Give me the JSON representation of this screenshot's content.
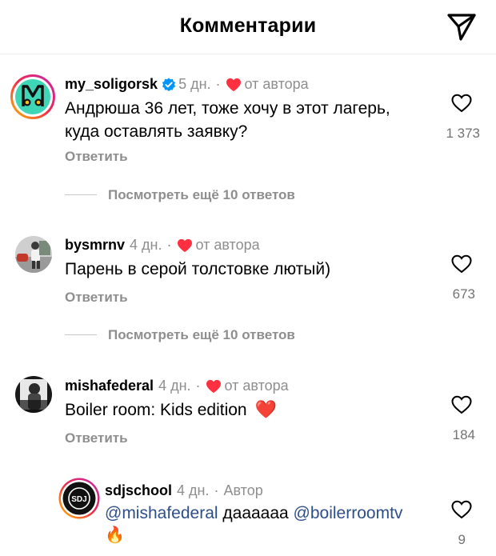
{
  "header": {
    "title": "Комментарии"
  },
  "comments": [
    {
      "username": "my_soligorsk",
      "time": "5 дн.",
      "sep": "·",
      "author_like": "от автора",
      "text_line1": "Андрюша 36 лет, тоже хочу в этот лагерь,",
      "text_line2": "куда оставлять заявку?",
      "reply_label": "Ответить",
      "likes": "1 373",
      "more_replies": "Посмотреть ещё 10 ответов"
    },
    {
      "username": "bysmrnv",
      "time": "4 дн.",
      "sep": "·",
      "author_like": "от автора",
      "text_line1": "Парень в серой толстовке лютый)",
      "reply_label": "Ответить",
      "likes": "673",
      "more_replies": "Посмотреть ещё 10 ответов"
    },
    {
      "username": "mishafederal",
      "time": "4 дн.",
      "sep": "·",
      "author_like": "от автора",
      "text_line1": "Boiler room: Kids edition",
      "emoji": "❤️",
      "reply_label": "Ответить",
      "likes": "184"
    },
    {
      "username": "sdjschool",
      "time": "4 дн.",
      "sep": "·",
      "author_label": "Автор",
      "mention1": "@mishafederal",
      "text_mid": " даааааа ",
      "mention2": "@boilerroomtv",
      "emoji": "🔥",
      "likes": "9",
      "avatar_text": "SDJ"
    }
  ],
  "colors": {
    "heart": "#ff3040",
    "verified": "#0095f6",
    "mention": "#2d4f8a",
    "muted": "#8e8e8e"
  }
}
